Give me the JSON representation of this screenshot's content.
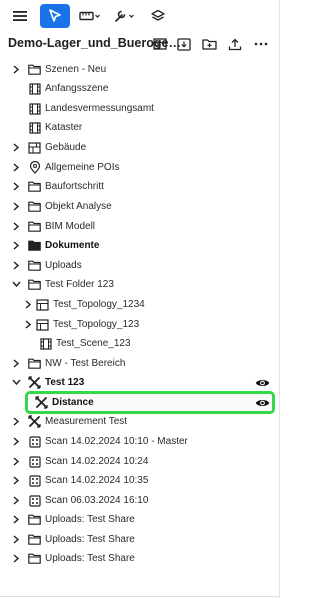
{
  "toolbar": {
    "menu_icon": "hamburger-menu-icon",
    "select_icon": "cursor-arrow-icon",
    "measure_icon": "ruler-dropdown-icon",
    "tools_icon": "wrench-dropdown-icon",
    "layers_icon": "layers-icon",
    "accent": "#1a73e8"
  },
  "project": {
    "title": "Demo-Lager_und_Bueroge…",
    "actions": [
      "table-icon",
      "import-icon",
      "new-folder-icon",
      "upload-icon",
      "more-icon"
    ]
  },
  "tree": [
    {
      "label": "Szenen - Neu",
      "icon": "folder-outline",
      "level": 0,
      "chevron": "right",
      "bold": false
    },
    {
      "label": "Anfangsszene",
      "icon": "scene",
      "level": 1,
      "chevron": "",
      "bold": false
    },
    {
      "label": "Landesvermessungsamt",
      "icon": "scene",
      "level": 1,
      "chevron": "",
      "bold": false
    },
    {
      "label": "Kataster",
      "icon": "scene",
      "level": 1,
      "chevron": "",
      "bold": false
    },
    {
      "label": "Gebäude",
      "icon": "building",
      "level": 0,
      "chevron": "right",
      "bold": false
    },
    {
      "label": "Allgemeine POIs",
      "icon": "pin",
      "level": 0,
      "chevron": "right",
      "bold": false
    },
    {
      "label": "Baufortschritt",
      "icon": "folder-outline",
      "level": 0,
      "chevron": "right",
      "bold": false
    },
    {
      "label": "Objekt Analyse",
      "icon": "folder-outline",
      "level": 0,
      "chevron": "right",
      "bold": false
    },
    {
      "label": "BIM Modell",
      "icon": "folder-outline",
      "level": 0,
      "chevron": "right",
      "bold": false
    },
    {
      "label": "Dokumente",
      "icon": "folder-filled",
      "level": 0,
      "chevron": "right",
      "bold": true
    },
    {
      "label": "Uploads",
      "icon": "folder-outline",
      "level": 0,
      "chevron": "right",
      "bold": false
    },
    {
      "label": "Test Folder 123",
      "icon": "folder-outline",
      "level": 0,
      "chevron": "down",
      "bold": false
    },
    {
      "label": "Test_Topology_1234",
      "icon": "table",
      "level": 1,
      "chevron": "right",
      "bold": false
    },
    {
      "label": "Test_Topology_123",
      "icon": "table",
      "level": 1,
      "chevron": "right",
      "bold": false
    },
    {
      "label": "Test_Scene_123",
      "icon": "scene",
      "level": 2,
      "chevron": "",
      "bold": false
    },
    {
      "label": "NW - Test Bereich",
      "icon": "folder-outline",
      "level": 0,
      "chevron": "right",
      "bold": false
    },
    {
      "label": "Test 123",
      "icon": "measure",
      "level": 0,
      "chevron": "down",
      "bold": true,
      "eye": true
    },
    {
      "label": "Distance",
      "icon": "measure",
      "level": 1,
      "chevron": "",
      "bold": true,
      "eye": true
    },
    {
      "label": "Measurement Test",
      "icon": "measure",
      "level": 0,
      "chevron": "right",
      "bold": false
    },
    {
      "label": "Scan 14.02.2024 10:10 - Master",
      "icon": "scan",
      "level": 0,
      "chevron": "right",
      "bold": false
    },
    {
      "label": "Scan 14.02.2024 10:24",
      "icon": "scan",
      "level": 0,
      "chevron": "right",
      "bold": false
    },
    {
      "label": "Scan 14.02.2024 10:35",
      "icon": "scan",
      "level": 0,
      "chevron": "right",
      "bold": false
    },
    {
      "label": "Scan 06.03.2024 16:10",
      "icon": "scan",
      "level": 0,
      "chevron": "right",
      "bold": false
    },
    {
      "label": "Uploads: Test Share",
      "icon": "folder-outline",
      "level": 0,
      "chevron": "right",
      "bold": false
    },
    {
      "label": "Uploads: Test Share",
      "icon": "folder-outline",
      "level": 0,
      "chevron": "right",
      "bold": false
    },
    {
      "label": "Uploads: Test Share",
      "icon": "folder-outline",
      "level": 0,
      "chevron": "right",
      "bold": false
    }
  ],
  "highlight_color": "#35d84a"
}
